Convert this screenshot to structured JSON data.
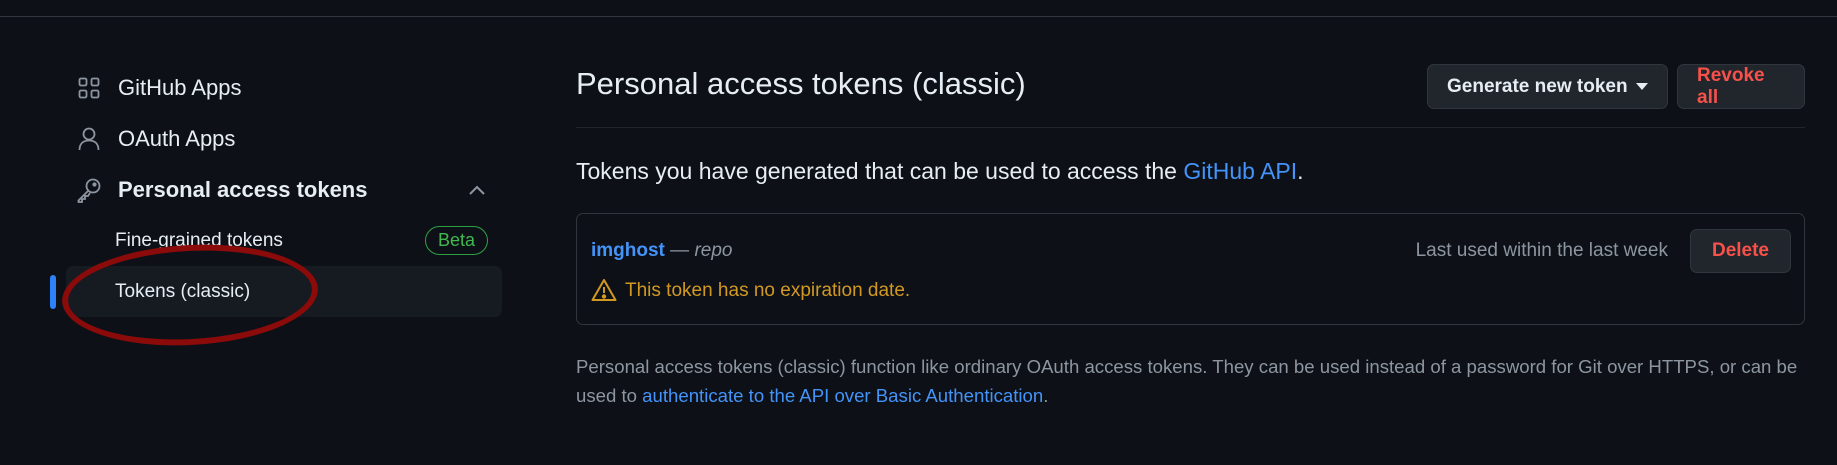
{
  "sidebar": {
    "items": [
      {
        "label": "GitHub Apps",
        "icon": "apps-grid-icon"
      },
      {
        "label": "OAuth Apps",
        "icon": "person-icon"
      },
      {
        "label": "Personal access tokens",
        "icon": "key-icon",
        "expanded": true
      }
    ],
    "subitems": [
      {
        "label": "Fine-grained tokens",
        "badge": "Beta"
      },
      {
        "label": "Tokens (classic)",
        "selected": true
      }
    ]
  },
  "main": {
    "title": "Personal access tokens (classic)",
    "generate_label": "Generate new token",
    "revoke_label": "Revoke all",
    "intro_text": "Tokens you have generated that can be used to access the ",
    "intro_link": "GitHub API",
    "intro_end": ".",
    "token": {
      "name": "imghost",
      "separator": " — ",
      "scope": "repo",
      "last_used": "Last used within the last week",
      "delete_label": "Delete",
      "warning": "This token has no expiration date."
    },
    "description_text": "Personal access tokens (classic) function like ordinary OAuth access tokens. They can be used instead of a password for Git over HTTPS, or can be used to ",
    "description_link": "authenticate to the API over Basic Authentication",
    "description_end": "."
  },
  "colors": {
    "background": "#0d1117",
    "link": "#4493f8",
    "danger": "#f85149",
    "warning": "#d29922",
    "success": "#3fb950",
    "accent": "#2f81f7",
    "annotation": "#8b0a0a"
  }
}
